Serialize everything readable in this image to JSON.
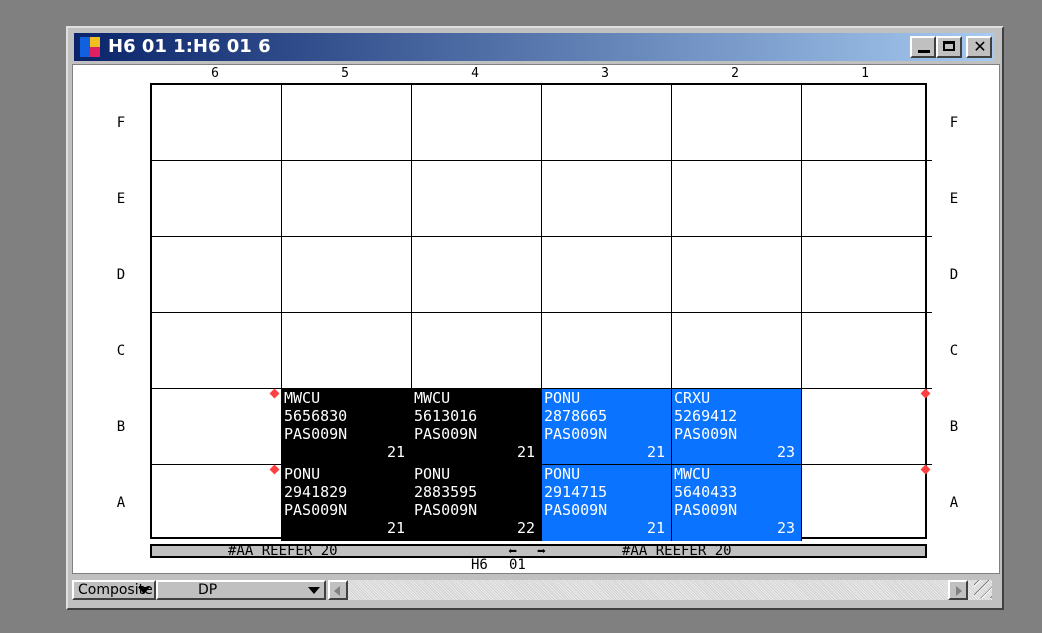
{
  "window": {
    "title": "H6 01 1:H6 01 6",
    "minimize_icon": "minimize-icon",
    "maximize_icon": "maximize-icon",
    "close_icon": "close-icon",
    "close_glyph": "✕"
  },
  "bays": [
    "6",
    "5",
    "4",
    "3",
    "2",
    "1"
  ],
  "rows": [
    "F",
    "E",
    "D",
    "C",
    "B",
    "A"
  ],
  "colors": {
    "black_slot": "#000000",
    "blue_slot": "#0a73ff",
    "reefer_marker": "#ff4040"
  },
  "slots": {
    "B": [
      {
        "empty": true,
        "reefer": true
      },
      {
        "prefix": "MWCU",
        "number": "5656830",
        "voyage": "PAS009N",
        "weight": "21",
        "color": "black"
      },
      {
        "prefix": "MWCU",
        "number": "5613016",
        "voyage": "PAS009N",
        "weight": "21",
        "color": "black"
      },
      {
        "prefix": "PONU",
        "number": "2878665",
        "voyage": "PAS009N",
        "weight": "21",
        "color": "blue"
      },
      {
        "prefix": "CRXU",
        "number": "5269412",
        "voyage": "PAS009N",
        "weight": "23",
        "color": "blue"
      },
      {
        "empty": true,
        "reefer": true
      }
    ],
    "A": [
      {
        "empty": true,
        "reefer": true
      },
      {
        "prefix": "PONU",
        "number": "2941829",
        "voyage": "PAS009N",
        "weight": "21",
        "color": "black"
      },
      {
        "prefix": "PONU",
        "number": "2883595",
        "voyage": "PAS009N",
        "weight": "22",
        "color": "black"
      },
      {
        "prefix": "PONU",
        "number": "2914715",
        "voyage": "PAS009N",
        "weight": "21",
        "color": "blue"
      },
      {
        "prefix": "MWCU",
        "number": "5640433",
        "voyage": "PAS009N",
        "weight": "23",
        "color": "blue"
      },
      {
        "empty": true,
        "reefer": true
      }
    ]
  },
  "footer": {
    "left_text": "#AA REEFER 20",
    "right_text": "#AA REEFER 20",
    "left_arrow_icon": "arrow-left-icon",
    "right_arrow_icon": "arrow-right-icon",
    "left_arrow": "⬅",
    "right_arrow": "➡",
    "bay_id_part1": "H6",
    "bay_id_part2": "01"
  },
  "bottom": {
    "view_select": "Composite",
    "mode_select": "DP"
  }
}
